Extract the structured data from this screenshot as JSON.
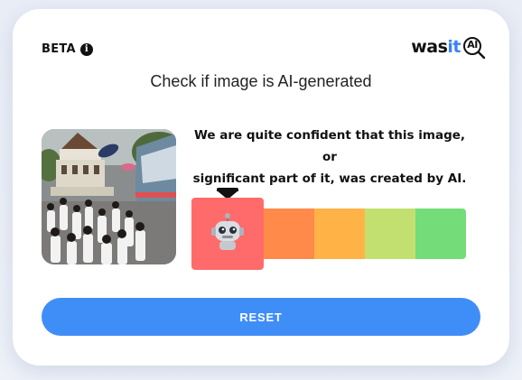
{
  "header": {
    "badge_label": "BETA",
    "info_icon": "info-icon",
    "logo": {
      "was": "was",
      "it": "it",
      "ai": "AI"
    }
  },
  "title": "Check if image is AI-generated",
  "result": {
    "line1": "We are quite confident that this image, or",
    "line2": "significant part of it, was created by AI.",
    "verdict_level": "ai-generated",
    "scale_position": 0,
    "scale_segments": 5,
    "marker_icon": "robot-icon"
  },
  "colors": {
    "primary": "#3f8ef7",
    "scale": [
      "#ff6b6b",
      "#ff8a4a",
      "#ffb347",
      "#c2e070",
      "#74dc78"
    ],
    "logo_it": "#3b82f6"
  },
  "image": {
    "icon": "uploaded-image"
  },
  "actions": {
    "reset_label": "RESET"
  }
}
